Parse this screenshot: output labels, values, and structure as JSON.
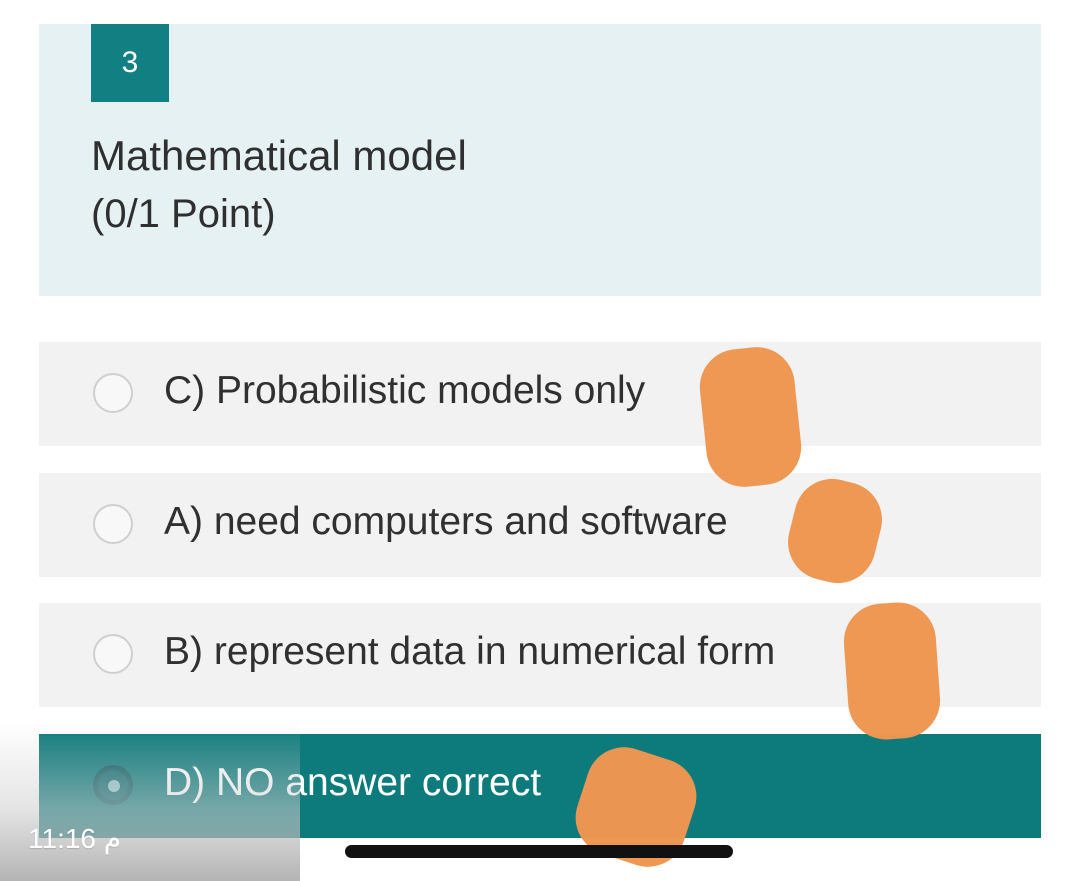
{
  "question": {
    "number": "3",
    "title": "Mathematical model",
    "points": "(0/1 Point)"
  },
  "options": [
    {
      "label": "C) Probabilistic models only",
      "selected": false
    },
    {
      "label": "A) need computers and software",
      "selected": false
    },
    {
      "label": "B) represent data in numerical form",
      "selected": false
    },
    {
      "label": "D) NO answer correct",
      "selected": true
    }
  ],
  "status_bar": {
    "time": "11:16 م"
  },
  "colors": {
    "question_bg": "#e5f1f3",
    "badge_bg": "#127f83",
    "selected_bg": "#0d7a7c",
    "scribble": "#ef9651"
  },
  "icons": {
    "radio": "radio-icon",
    "home_indicator": "home-indicator"
  }
}
